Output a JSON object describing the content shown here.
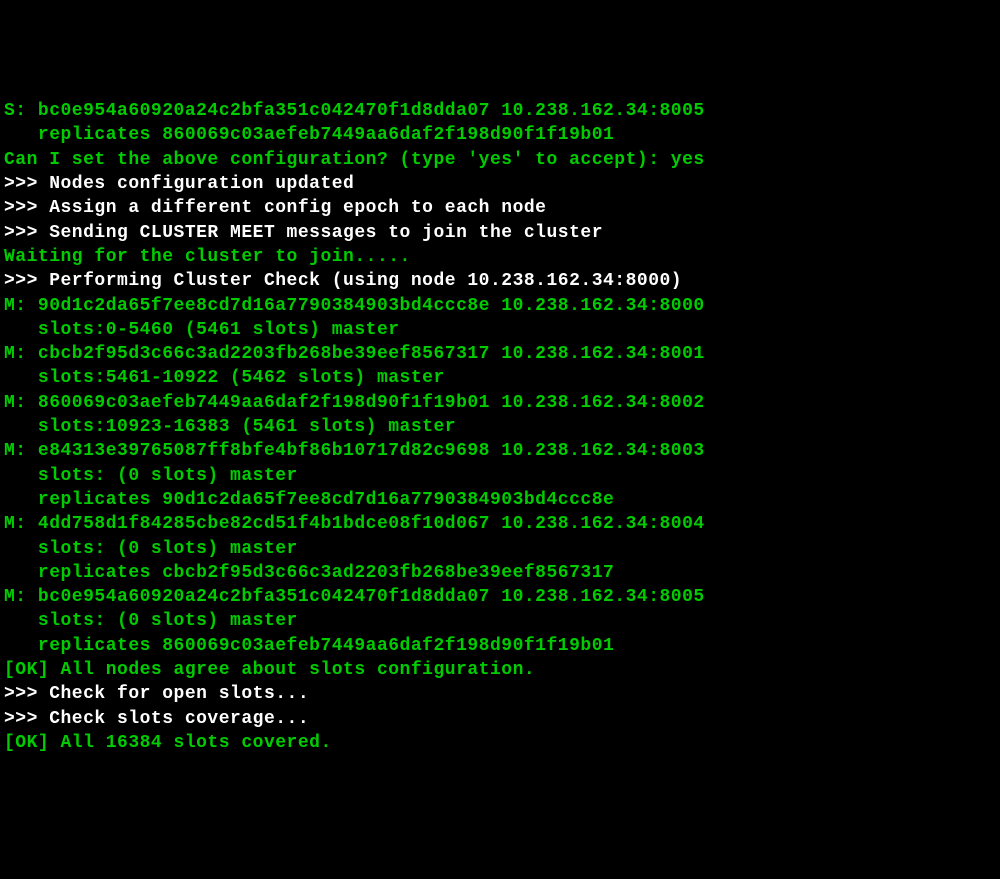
{
  "lines": [
    {
      "cls": "green",
      "text": "S: bc0e954a60920a24c2bfa351c042470f1d8dda07 10.238.162.34:8005"
    },
    {
      "cls": "green",
      "text": "   replicates 860069c03aefeb7449aa6daf2f198d90f1f19b01"
    },
    {
      "cls": "green",
      "text": "Can I set the above configuration? (type 'yes' to accept): yes"
    },
    {
      "cls": "white",
      "text": ">>> Nodes configuration updated"
    },
    {
      "cls": "white",
      "text": ">>> Assign a different config epoch to each node"
    },
    {
      "cls": "white",
      "text": ">>> Sending CLUSTER MEET messages to join the cluster"
    },
    {
      "cls": "green",
      "text": "Waiting for the cluster to join....."
    },
    {
      "cls": "white",
      "text": ">>> Performing Cluster Check (using node 10.238.162.34:8000)"
    },
    {
      "cls": "green",
      "text": "M: 90d1c2da65f7ee8cd7d16a7790384903bd4ccc8e 10.238.162.34:8000"
    },
    {
      "cls": "green",
      "text": "   slots:0-5460 (5461 slots) master"
    },
    {
      "cls": "green",
      "text": "M: cbcb2f95d3c66c3ad2203fb268be39eef8567317 10.238.162.34:8001"
    },
    {
      "cls": "green",
      "text": "   slots:5461-10922 (5462 slots) master"
    },
    {
      "cls": "green",
      "text": "M: 860069c03aefeb7449aa6daf2f198d90f1f19b01 10.238.162.34:8002"
    },
    {
      "cls": "green",
      "text": "   slots:10923-16383 (5461 slots) master"
    },
    {
      "cls": "green",
      "text": "M: e84313e39765087ff8bfe4bf86b10717d82c9698 10.238.162.34:8003"
    },
    {
      "cls": "green",
      "text": "   slots: (0 slots) master"
    },
    {
      "cls": "green",
      "text": "   replicates 90d1c2da65f7ee8cd7d16a7790384903bd4ccc8e"
    },
    {
      "cls": "green",
      "text": "M: 4dd758d1f84285cbe82cd51f4b1bdce08f10d067 10.238.162.34:8004"
    },
    {
      "cls": "green",
      "text": "   slots: (0 slots) master"
    },
    {
      "cls": "green",
      "text": "   replicates cbcb2f95d3c66c3ad2203fb268be39eef8567317"
    },
    {
      "cls": "green",
      "text": "M: bc0e954a60920a24c2bfa351c042470f1d8dda07 10.238.162.34:8005"
    },
    {
      "cls": "green",
      "text": "   slots: (0 slots) master"
    },
    {
      "cls": "green",
      "text": "   replicates 860069c03aefeb7449aa6daf2f198d90f1f19b01"
    },
    {
      "cls": "green",
      "text": "[OK] All nodes agree about slots configuration."
    },
    {
      "cls": "white",
      "text": ">>> Check for open slots..."
    },
    {
      "cls": "white",
      "text": ">>> Check slots coverage..."
    },
    {
      "cls": "green",
      "text": "[OK] All 16384 slots covered."
    }
  ]
}
